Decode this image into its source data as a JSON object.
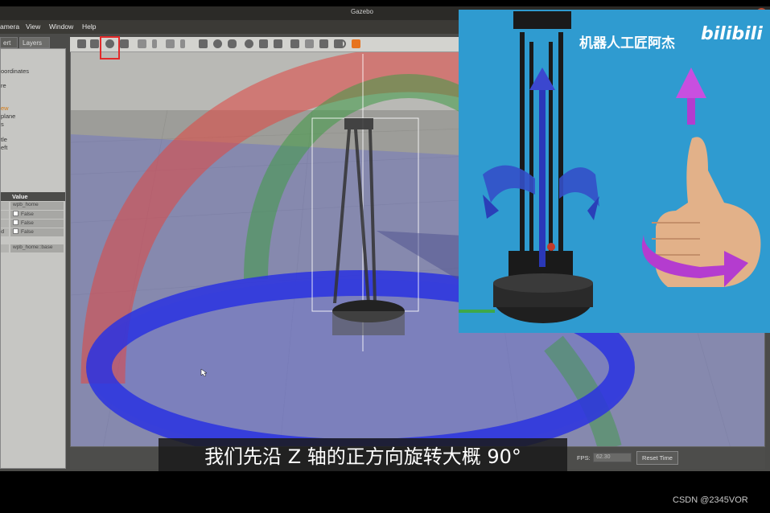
{
  "window": {
    "title": "Gazebo"
  },
  "menu": {
    "items": [
      "amera",
      "View",
      "Window",
      "Help"
    ]
  },
  "left_panel": {
    "tabs": [
      "ert",
      "Layers"
    ],
    "tree_items": [
      "oordinates",
      "re",
      "ew",
      "plane",
      "s",
      "tle",
      "eft"
    ],
    "properties": {
      "header": "Value",
      "rows": [
        {
          "label": "",
          "value": "wpb_home",
          "checkbox": false
        },
        {
          "label": "",
          "value": "False",
          "checkbox": true
        },
        {
          "label": "",
          "value": "False",
          "checkbox": true
        },
        {
          "label": "d",
          "value": "False",
          "checkbox": true
        },
        {
          "label": "",
          "value": "wpb_home::base",
          "checkbox": false
        }
      ]
    }
  },
  "toolbar": {
    "icons": [
      "select-arrow-icon",
      "translate-icon",
      "rotate-icon",
      "scale-icon",
      "undo-icon",
      "undo-dropdown-icon",
      "redo-icon",
      "redo-dropdown-icon",
      "box-icon",
      "sphere-icon",
      "cylinder-icon",
      "point-light-icon",
      "spot-light-icon",
      "directional-light-icon",
      "copy-icon",
      "paste-icon",
      "align-icon",
      "snap-icon",
      "magnet-icon",
      "screenshot-icon"
    ],
    "highlighted": "rotate-icon"
  },
  "status": {
    "fps_label": "FPS:",
    "fps_value": "62.30",
    "reset_time_label": "Reset Time"
  },
  "overlay": {
    "watermark_text": "机器人工匠阿杰",
    "platform_logo": "bilibili"
  },
  "subtitle": "我们先沿 Z 轴的正方向旋转大概 90°",
  "credit": "CSDN @2345VOR",
  "colors": {
    "ring_red": "#e2453f",
    "ring_green": "#3f9a45",
    "ring_blue": "#2a32e0",
    "highlight_box": "#e22a2a",
    "overlay_bg": "#2f9bd0",
    "arrow_purple": "#b43ccf"
  }
}
